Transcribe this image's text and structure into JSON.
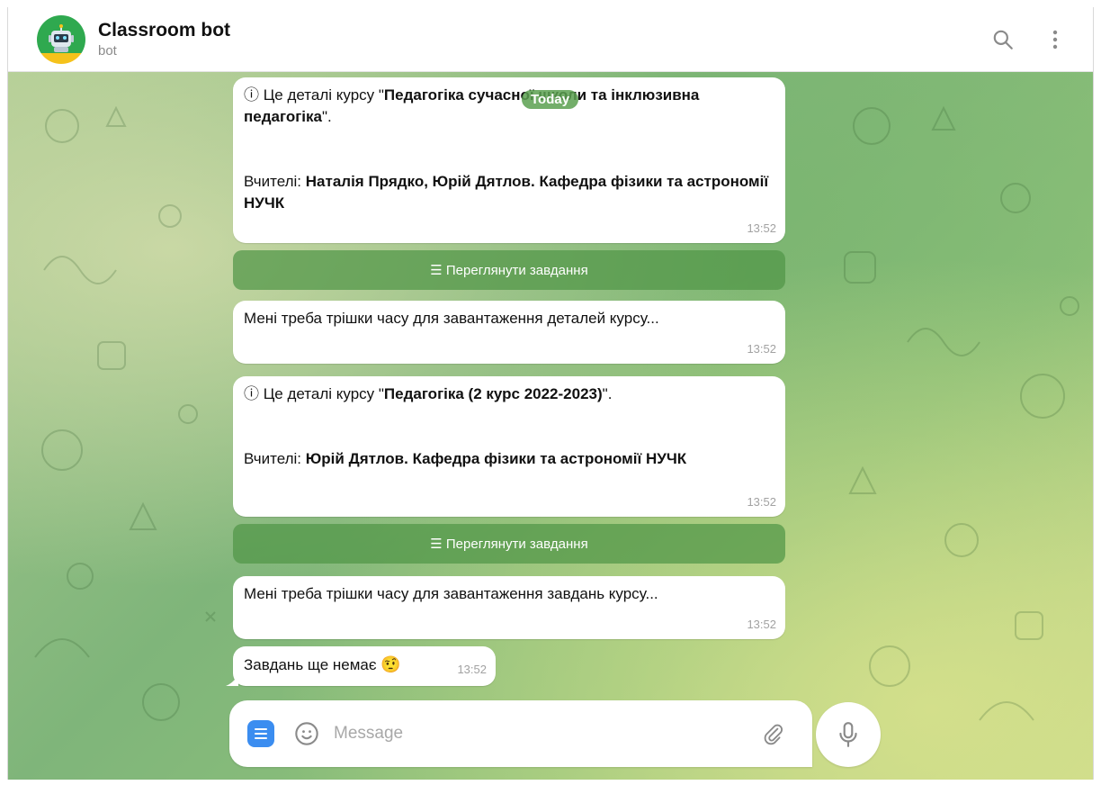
{
  "header": {
    "title": "Classroom bot",
    "subtitle": "bot"
  },
  "date_badge": "Today",
  "messages": [
    {
      "prefix": "ⓘ Це деталі курсу \"",
      "course": "Педагогіка сучасної школи та інклюзивна педагогіка",
      "suffix": "\".",
      "teachers_label": "Вчителі: ",
      "teachers": "Наталія Прядко, Юрій Дятлов. Кафедра фізики та астрономії НУЧК",
      "time": "13:52"
    },
    {
      "button": "☰ Переглянути завдання"
    },
    {
      "text": "Мені треба трішки часу для завантаження деталей курсу...",
      "time": "13:52"
    },
    {
      "prefix": "ⓘ Це деталі курсу \"",
      "course": "Педагогіка (2 курс 2022-2023)",
      "suffix": "\".",
      "teachers_label": "Вчителі: ",
      "teachers": "Юрій Дятлов. Кафедра фізики та астрономії НУЧК",
      "time": "13:52"
    },
    {
      "button": "☰ Переглянути завдання"
    },
    {
      "text": "Мені треба трішки часу для завантаження завдань курсу...",
      "time": "13:52"
    },
    {
      "text": "Завдань ще немає",
      "emoji": "🤨",
      "time": "13:52"
    }
  ],
  "composer": {
    "placeholder": "Message"
  },
  "icons": {
    "search": "search-icon",
    "more": "more-vertical-icon",
    "menu": "menu-icon",
    "emoji": "emoji-icon",
    "attach": "paperclip-icon",
    "mic": "microphone-icon"
  },
  "colors": {
    "accent": "#3b8df0",
    "bot_button": "#5a9a4f",
    "bubble": "#ffffff"
  }
}
